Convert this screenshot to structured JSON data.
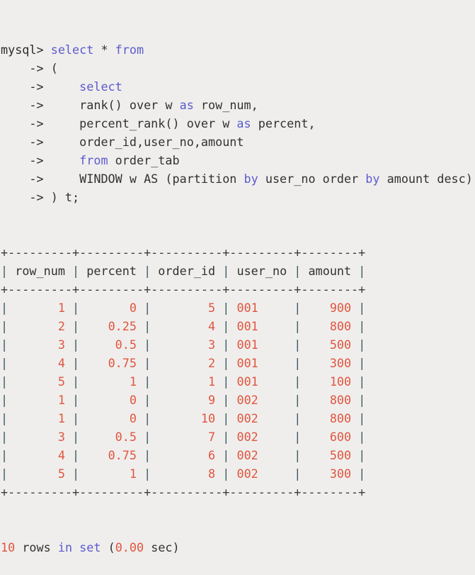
{
  "terminal": {
    "prompt_primary": "mysql>",
    "prompt_continuation": "->",
    "query_lines": [
      {
        "prompt": "mysql>",
        "indent": 0,
        "tokens": [
          {
            "t": " select",
            "c": "kw"
          },
          {
            "t": " * ",
            "c": "plain"
          },
          {
            "t": "from",
            "c": "kw"
          }
        ]
      },
      {
        "prompt": "->",
        "indent": 4,
        "tokens": [
          {
            "t": " (",
            "c": "plain"
          }
        ]
      },
      {
        "prompt": "->",
        "indent": 4,
        "tokens": [
          {
            "t": "     select",
            "c": "kw"
          }
        ]
      },
      {
        "prompt": "->",
        "indent": 4,
        "tokens": [
          {
            "t": "     rank() over w ",
            "c": "plain"
          },
          {
            "t": "as",
            "c": "kw"
          },
          {
            "t": " row_num,",
            "c": "plain"
          }
        ]
      },
      {
        "prompt": "->",
        "indent": 4,
        "tokens": [
          {
            "t": "     percent_rank() over w ",
            "c": "plain"
          },
          {
            "t": "as",
            "c": "kw"
          },
          {
            "t": " percent,",
            "c": "plain"
          }
        ]
      },
      {
        "prompt": "->",
        "indent": 4,
        "tokens": [
          {
            "t": "     order_id,user_no,amount",
            "c": "plain"
          }
        ]
      },
      {
        "prompt": "->",
        "indent": 4,
        "tokens": [
          {
            "t": "     ",
            "c": "plain"
          },
          {
            "t": "from",
            "c": "kw"
          },
          {
            "t": " order_tab",
            "c": "plain"
          }
        ]
      },
      {
        "prompt": "->",
        "indent": 4,
        "tokens": [
          {
            "t": "     WINDOW w AS (partition ",
            "c": "plain"
          },
          {
            "t": "by",
            "c": "kw"
          },
          {
            "t": " user_no order ",
            "c": "plain"
          },
          {
            "t": "by",
            "c": "kw"
          },
          {
            "t": " amount desc)",
            "c": "plain"
          }
        ]
      },
      {
        "prompt": "->",
        "indent": 4,
        "tokens": [
          {
            "t": " ) t;",
            "c": "plain"
          }
        ]
      }
    ],
    "result_table": {
      "rule": "+---------+---------+----------+---------+--------+",
      "columns": [
        {
          "name": "row_num",
          "width": 9,
          "align": "right"
        },
        {
          "name": "percent",
          "width": 9,
          "align": "right"
        },
        {
          "name": "order_id",
          "width": 10,
          "align": "right"
        },
        {
          "name": "user_no",
          "width": 9,
          "align": "left"
        },
        {
          "name": "amount",
          "width": 8,
          "align": "right"
        }
      ],
      "rows": [
        [
          "1",
          "0",
          "5",
          "001",
          "900"
        ],
        [
          "2",
          "0.25",
          "4",
          "001",
          "800"
        ],
        [
          "3",
          "0.5",
          "3",
          "001",
          "500"
        ],
        [
          "4",
          "0.75",
          "2",
          "001",
          "300"
        ],
        [
          "5",
          "1",
          "1",
          "001",
          "100"
        ],
        [
          "1",
          "0",
          "9",
          "002",
          "800"
        ],
        [
          "1",
          "0",
          "10",
          "002",
          "800"
        ],
        [
          "3",
          "0.5",
          "7",
          "002",
          "600"
        ],
        [
          "4",
          "0.75",
          "6",
          "002",
          "500"
        ],
        [
          "5",
          "1",
          "8",
          "002",
          "300"
        ]
      ]
    },
    "status_line": {
      "count": "10",
      "rows_word": " rows ",
      "in_set": "in set",
      "open_paren": " (",
      "time": "0.00",
      "sec_word": " sec",
      "close_paren": ")"
    }
  },
  "colors": {
    "background": "#efeeec",
    "text": "#333230",
    "keyword": "#5b5bce",
    "value": "#e0553f",
    "border": "#3b3b3b",
    "pipe": "#3c5d62"
  }
}
